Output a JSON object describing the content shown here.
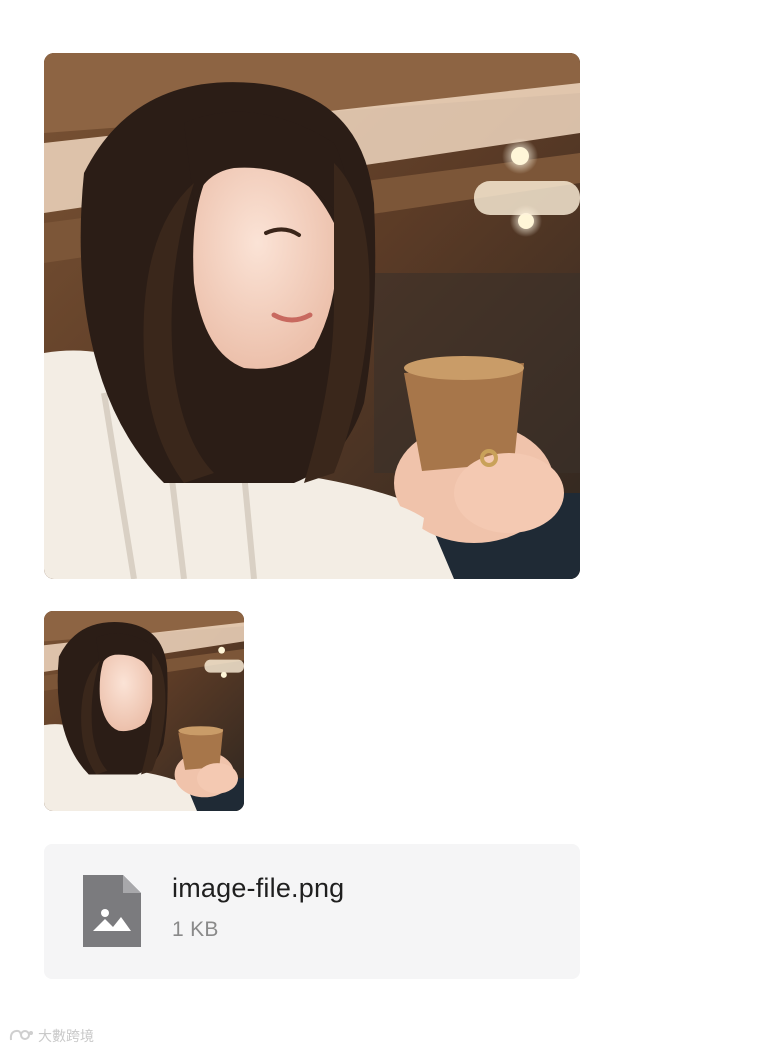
{
  "images": [
    {
      "name": "photo-large"
    },
    {
      "name": "photo-thumbnail"
    }
  ],
  "attachment": {
    "file_name": "image-file.png",
    "file_size": "1 KB",
    "icon": "image-file-icon"
  },
  "watermark": {
    "text": "大數跨境"
  }
}
